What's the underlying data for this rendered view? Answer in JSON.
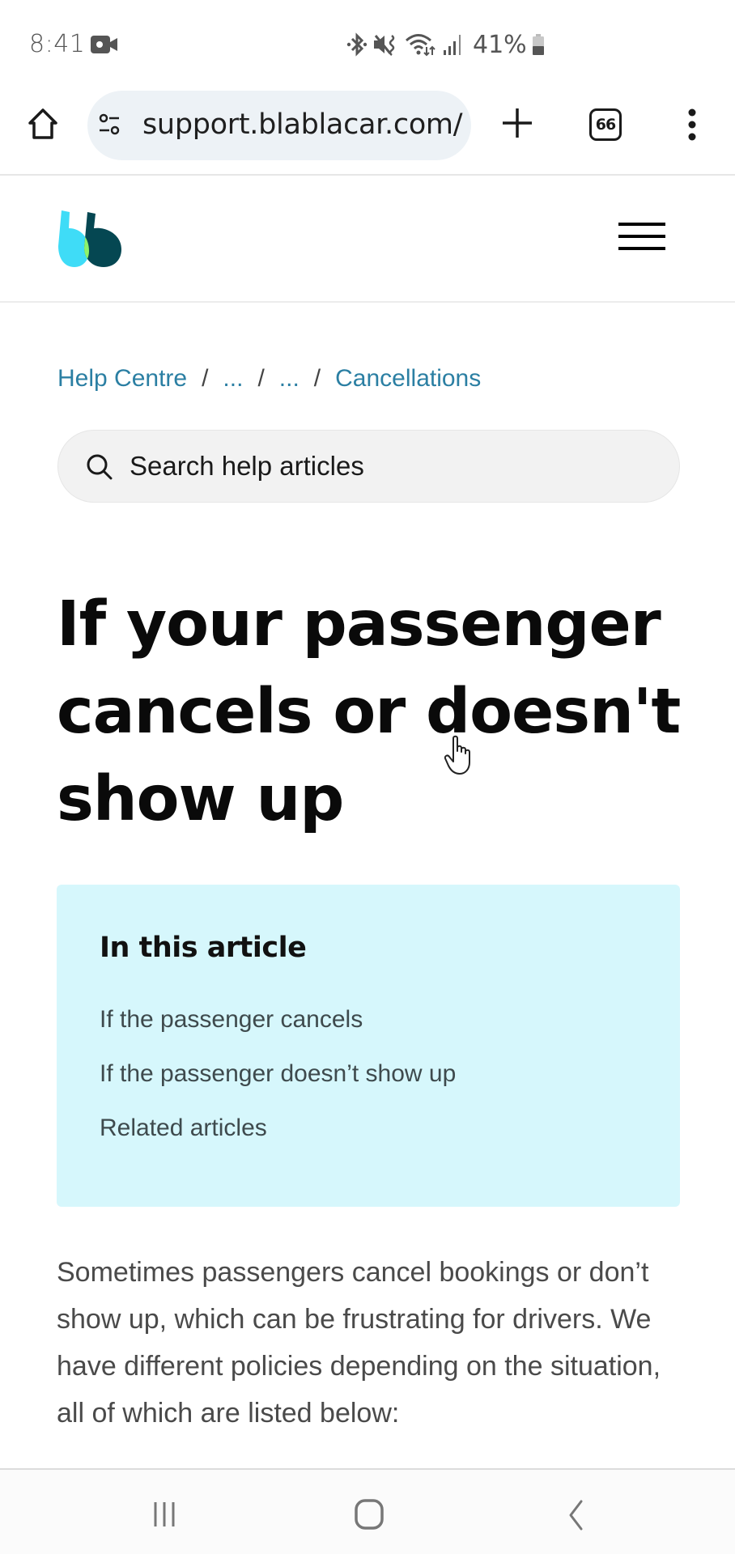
{
  "status_bar": {
    "time": "8:41",
    "battery_percent": "41%",
    "icons": [
      "camera-icon",
      "bluetooth-icon",
      "mute-vibrate-icon",
      "wifi-icon",
      "signal-icon",
      "battery-icon"
    ]
  },
  "browser": {
    "url": "support.blablacar.com/",
    "tab_count": "66"
  },
  "site": {
    "brand_colors": {
      "cyan": "#3fdcf7",
      "dark_teal": "#054752",
      "green": "#8ef36b"
    }
  },
  "breadcrumb": {
    "items": [
      {
        "label": "Help Centre"
      },
      {
        "label": "..."
      },
      {
        "label": "..."
      },
      {
        "label": "Cancellations"
      }
    ],
    "separator": "/"
  },
  "search": {
    "placeholder": "Search help articles"
  },
  "article": {
    "title": "If your passenger cancels or doesn't show up",
    "toc": {
      "title": "In this article",
      "items": [
        {
          "label": "If the passenger cancels"
        },
        {
          "label": "If the passenger doesn’t show up"
        },
        {
          "label": "Related articles"
        }
      ]
    },
    "intro": "Sometimes passengers cancel bookings or don’t show up, which can be frustrating for drivers. We have different policies depending on the situation, all of which are listed below:"
  }
}
